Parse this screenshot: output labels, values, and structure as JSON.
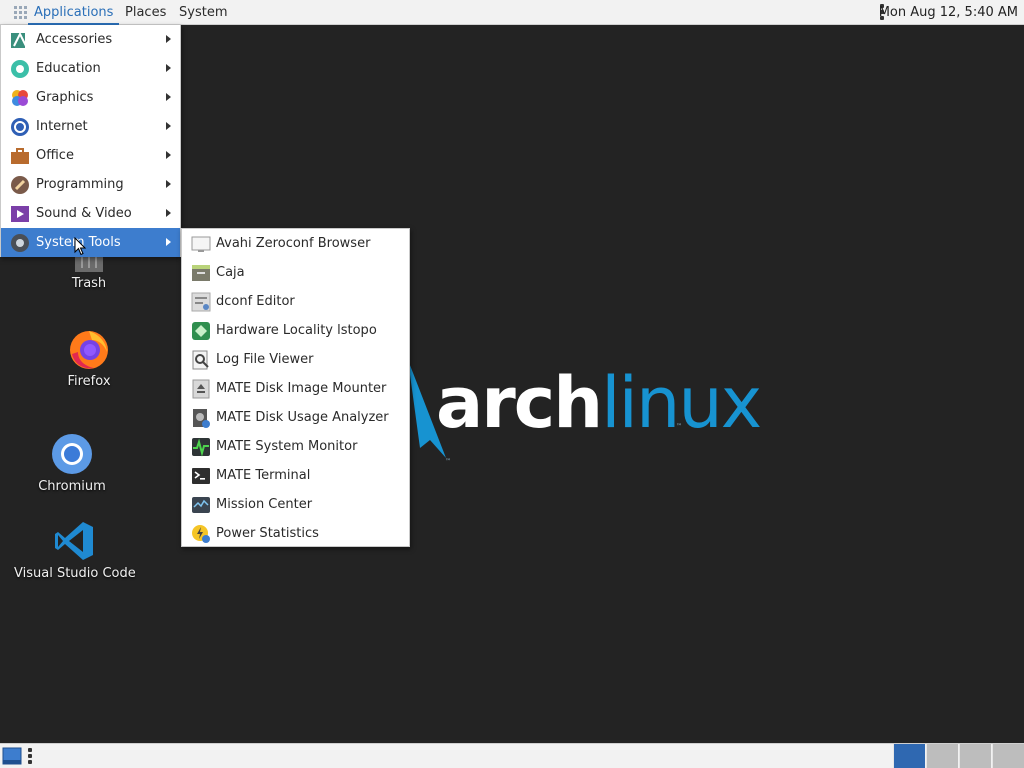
{
  "top_panel": {
    "menus": [
      "Applications",
      "Places",
      "System"
    ],
    "clock": "Mon Aug 12,  5:40 AM"
  },
  "desktop": {
    "icons": [
      {
        "label": "Trash",
        "icon": "trash-icon"
      },
      {
        "label": "Firefox",
        "icon": "firefox-icon"
      },
      {
        "label": "Chromium",
        "icon": "chromium-icon"
      },
      {
        "label": "Visual Studio Code",
        "icon": "vscode-icon"
      }
    ],
    "wallpaper_logo": {
      "text_main": "arch",
      "text_accent": "linux",
      "trademark": "™"
    }
  },
  "applications_menu": {
    "items": [
      {
        "label": "Accessories",
        "icon": "accessories-icon"
      },
      {
        "label": "Education",
        "icon": "education-icon"
      },
      {
        "label": "Graphics",
        "icon": "graphics-icon"
      },
      {
        "label": "Internet",
        "icon": "internet-icon"
      },
      {
        "label": "Office",
        "icon": "office-icon"
      },
      {
        "label": "Programming",
        "icon": "programming-icon"
      },
      {
        "label": "Sound & Video",
        "icon": "sound-video-icon"
      },
      {
        "label": "System Tools",
        "icon": "system-tools-icon",
        "active": true
      }
    ]
  },
  "system_tools_submenu": {
    "items": [
      {
        "label": "Avahi Zeroconf Browser",
        "icon": "avahi-icon"
      },
      {
        "label": "Caja",
        "icon": "caja-icon"
      },
      {
        "label": "dconf Editor",
        "icon": "dconf-icon"
      },
      {
        "label": "Hardware Locality lstopo",
        "icon": "hwloc-icon"
      },
      {
        "label": "Log File Viewer",
        "icon": "log-viewer-icon"
      },
      {
        "label": "MATE Disk Image Mounter",
        "icon": "disk-mounter-icon"
      },
      {
        "label": "MATE Disk Usage Analyzer",
        "icon": "disk-usage-icon"
      },
      {
        "label": "MATE System Monitor",
        "icon": "system-monitor-icon"
      },
      {
        "label": "MATE Terminal",
        "icon": "terminal-icon"
      },
      {
        "label": "Mission Center",
        "icon": "mission-center-icon"
      },
      {
        "label": "Power Statistics",
        "icon": "power-stats-icon"
      }
    ]
  },
  "colors": {
    "desktop_bg": "#232323",
    "accent": "#3d7dce",
    "arch_blue": "#1793d1",
    "panel_bg": "#f2f2f2"
  },
  "bottom_panel": {
    "workspaces": 4,
    "active_workspace": 1
  }
}
